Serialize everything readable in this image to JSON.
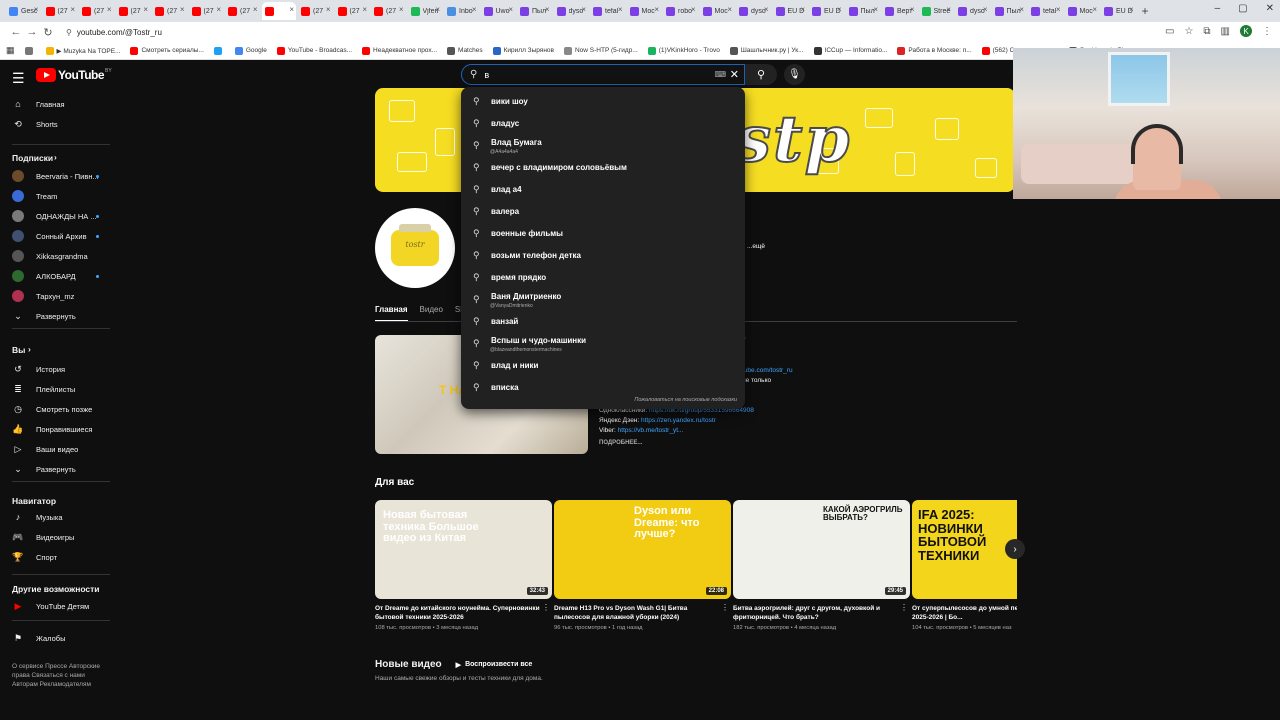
{
  "browser": {
    "tabs": [
      {
        "label": "Gesc",
        "color": "#4285f4"
      },
      {
        "label": "(27",
        "color": "#ff0000"
      },
      {
        "label": "(27",
        "color": "#ff0000"
      },
      {
        "label": "(27",
        "color": "#ff0000"
      },
      {
        "label": "(27",
        "color": "#ff0000"
      },
      {
        "label": "(27",
        "color": "#ff0000"
      },
      {
        "label": "(27",
        "color": "#ff0000"
      },
      {
        "label": "",
        "color": "#ff0000",
        "active": true
      },
      {
        "label": "(27",
        "color": "#ff0000"
      },
      {
        "label": "(27",
        "color": "#ff0000"
      },
      {
        "label": "(27",
        "color": "#ff0000"
      },
      {
        "label": "Vjfen",
        "color": "#1db954"
      },
      {
        "label": "Inbo",
        "color": "#4a90e2"
      },
      {
        "label": "Uwo",
        "color": "#7b3fe4"
      },
      {
        "label": "Пыл",
        "color": "#7b3fe4"
      },
      {
        "label": "dyso",
        "color": "#7b3fe4"
      },
      {
        "label": "tefal",
        "color": "#7b3fe4"
      },
      {
        "label": "Мос",
        "color": "#7b3fe4"
      },
      {
        "label": "robo",
        "color": "#7b3fe4"
      },
      {
        "label": "Мос",
        "color": "#7b3fe4"
      },
      {
        "label": "dyso",
        "color": "#7b3fe4"
      },
      {
        "label": "EU D",
        "color": "#7b3fe4"
      },
      {
        "label": "EU D",
        "color": "#7b3fe4"
      },
      {
        "label": "Пыл",
        "color": "#7b3fe4"
      },
      {
        "label": "Верт",
        "color": "#7b3fe4"
      },
      {
        "label": "Stree",
        "color": "#1db954"
      },
      {
        "label": "dyso",
        "color": "#7b3fe4"
      },
      {
        "label": "Пыл",
        "color": "#7b3fe4"
      },
      {
        "label": "tefal",
        "color": "#7b3fe4"
      },
      {
        "label": "Мос",
        "color": "#7b3fe4"
      },
      {
        "label": "EU D",
        "color": "#7b3fe4"
      }
    ],
    "url": "youtube.com/@Tostr_ru",
    "bookmarks": [
      {
        "label": "",
        "color": "#777"
      },
      {
        "label": "▶ Muzyka Na ТОРЕ...",
        "color": "#f5b400"
      },
      {
        "label": "Смотреть сериалы...",
        "color": "#ff0000"
      },
      {
        "label": "",
        "color": "#1da1f2"
      },
      {
        "label": "Google",
        "color": "#4285f4"
      },
      {
        "label": "YouTube - Broadcas...",
        "color": "#ff0000"
      },
      {
        "label": "Неадекватное прох...",
        "color": "#ff0000"
      },
      {
        "label": "Matches",
        "color": "#555"
      },
      {
        "label": "Кирилл Зырянов",
        "color": "#2b65c8"
      },
      {
        "label": "Now S-HTP (5-гидр...",
        "color": "#888"
      },
      {
        "label": "(1)VKinkHoro - Trovo",
        "color": "#19b45f"
      },
      {
        "label": "Шашлычник.ру | Ук...",
        "color": "#555"
      },
      {
        "label": "ICCup — Informatio...",
        "color": "#333"
      },
      {
        "label": "Работа в Москве: п...",
        "color": "#d22"
      },
      {
        "label": "(562) Самая страшн...",
        "color": "#ff0000"
      },
      {
        "label": "Dashboard - Player...",
        "color": "#555"
      }
    ]
  },
  "youtube": {
    "logo_text": "YouTube",
    "logo_region": "BY",
    "search": {
      "query": "в",
      "suggestions": [
        {
          "text": "вики шоу",
          "sub": ""
        },
        {
          "text": "владус",
          "sub": ""
        },
        {
          "text": "Влад Бумага",
          "sub": "@A4a4a4a4"
        },
        {
          "text": "вечер с владимиром соловьёвым",
          "sub": ""
        },
        {
          "text": "влад а4",
          "sub": ""
        },
        {
          "text": "валера",
          "sub": ""
        },
        {
          "text": "военные фильмы",
          "sub": ""
        },
        {
          "text": "возьми телефон детка",
          "sub": ""
        },
        {
          "text": "время прядко",
          "sub": ""
        },
        {
          "text": "Ваня Дмитриенко",
          "sub": "@VanyaDmitrienko"
        },
        {
          "text": "ванзай",
          "sub": ""
        },
        {
          "text": "Вспыш и чудо-машинки",
          "sub": "@blazeandthemonstermachines"
        },
        {
          "text": "влад и ники",
          "sub": ""
        },
        {
          "text": "вписка",
          "sub": ""
        }
      ],
      "report_text": "Пожаловаться на поисковые подсказки"
    },
    "sidebar": {
      "main": [
        {
          "label": "Главная",
          "icon": "home-icon",
          "glyph": "⌂"
        },
        {
          "label": "Shorts",
          "icon": "shorts-icon",
          "glyph": "⟲"
        }
      ],
      "subs_title": "Подписки",
      "subscriptions": [
        {
          "label": "Beervaria - Пивн...",
          "color": "#6b4b2a",
          "dot": true
        },
        {
          "label": "Tream",
          "color": "#3a6ad6",
          "dot": false
        },
        {
          "label": "ОДНАЖДЫ НА ...",
          "color": "#7a7a7a",
          "dot": true
        },
        {
          "label": "Сонный Архив",
          "color": "#405070",
          "dot": true
        },
        {
          "label": "Xikkasgrandma",
          "color": "#555",
          "dot": false
        },
        {
          "label": "АЛКОБАРД",
          "color": "#2d6a2d",
          "dot": true
        },
        {
          "label": "Тархун_mz",
          "color": "#b03050",
          "dot": false
        }
      ],
      "expand_subs": "Развернуть",
      "you_title": "Вы",
      "you": [
        {
          "label": "История",
          "icon": "history-icon",
          "glyph": "↺"
        },
        {
          "label": "Плейлисты",
          "icon": "playlists-icon",
          "glyph": "≣"
        },
        {
          "label": "Смотреть позже",
          "icon": "watch-later-icon",
          "glyph": "◷"
        },
        {
          "label": "Понравившиеся",
          "icon": "like-icon",
          "glyph": "👍"
        },
        {
          "label": "Ваши видео",
          "icon": "your-videos-icon",
          "glyph": "▷"
        },
        {
          "label": "Развернуть",
          "icon": "chevron-down-icon",
          "glyph": "⌄"
        }
      ],
      "nav_title": "Навигатор",
      "navigator": [
        {
          "label": "Музыка",
          "icon": "music-icon",
          "glyph": "♪"
        },
        {
          "label": "Видеоигры",
          "icon": "gaming-icon",
          "glyph": "🎮"
        },
        {
          "label": "Спорт",
          "icon": "trophy-icon",
          "glyph": "🏆"
        }
      ],
      "more_title": "Другие возможности",
      "more": [
        {
          "label": "YouTube Детям",
          "icon": "youtube-kids-icon",
          "glyph": "▶"
        }
      ],
      "report": {
        "label": "Жалобы",
        "icon": "flag-icon",
        "glyph": "⚑"
      },
      "footer": "О сервисе  Прессе  Авторские права  Связаться с нами  Авторам  Рекламодателям"
    },
    "channel": {
      "banner_word": "stр",
      "avatar_text": "tostr",
      "more_link": "...ещё",
      "tabs": [
        "Главная",
        "Видео",
        "Sh"
      ],
      "featured_caption": "Т НА",
      "description": [
        {
          "prefix": "",
          "link": "",
          "tail": "е"
        },
        {
          "prefix": "",
          "link": "tube.com/tostr_ru",
          "tail": ""
        },
        {
          "prefix": "",
          "link": "",
          "tail": "не только"
        },
        {
          "prefix": "Одноклассники: ",
          "link": "https://ok.ru/group/55331596664908",
          "tail": ""
        },
        {
          "prefix": "Яндекс Дзен: ",
          "link": "https://zen.yandex.ru/tostr",
          "tail": ""
        },
        {
          "prefix": "Viber: ",
          "link": "https://vb.me/tostr_yt...",
          "tail": ""
        }
      ],
      "details": "ПОДРОБНЕЕ..."
    },
    "for_you": {
      "title": "Для вас",
      "videos": [
        {
          "title": "От Dreame до китайского ноунейма. Суперновинки бытовой техники 2025-2026",
          "views": "108 тыс. просмотров",
          "age": "3 месяца назад",
          "duration": "32:43",
          "caption": "Новая бытовая техника   Большое видео из Китая",
          "bg": "#e8e4d8"
        },
        {
          "title": "Dreame H13 Pro vs Dyson Wash G1| Битва пылесосов для влажной уборки (2024)",
          "views": "96 тыс. просмотров",
          "age": "1 год назад",
          "duration": "22:08",
          "caption": "Dyson или Dreame: что лучше?",
          "bg": "#f2cc12"
        },
        {
          "title": "Битва аэрогрилей: друг с другом, духовкой и фритюрницей. Что брать?",
          "views": "182 тыс. просмотров",
          "age": "4 месяца назад",
          "duration": "29:45",
          "caption": "КАКОЙ АЭРОГРИЛЬ ВЫБРАТЬ?",
          "bg": "#f0f0ea"
        },
        {
          "title": "От суперпылесосов до умной пе... новинки техники 2025-2026 | Бо...",
          "views": "104 тыс. просмотров",
          "age": "5 месяцев наз",
          "duration": "",
          "caption": "IFA 2025: НОВИНКИ БЫТОВОЙ ТЕХНИКИ",
          "bg": "#f3d51c"
        }
      ]
    },
    "new_videos": {
      "title": "Новые видео",
      "play_all": "Воспроизвести все",
      "subtitle": "Наши самые свежие обзоры и тесты техники для дома."
    }
  }
}
